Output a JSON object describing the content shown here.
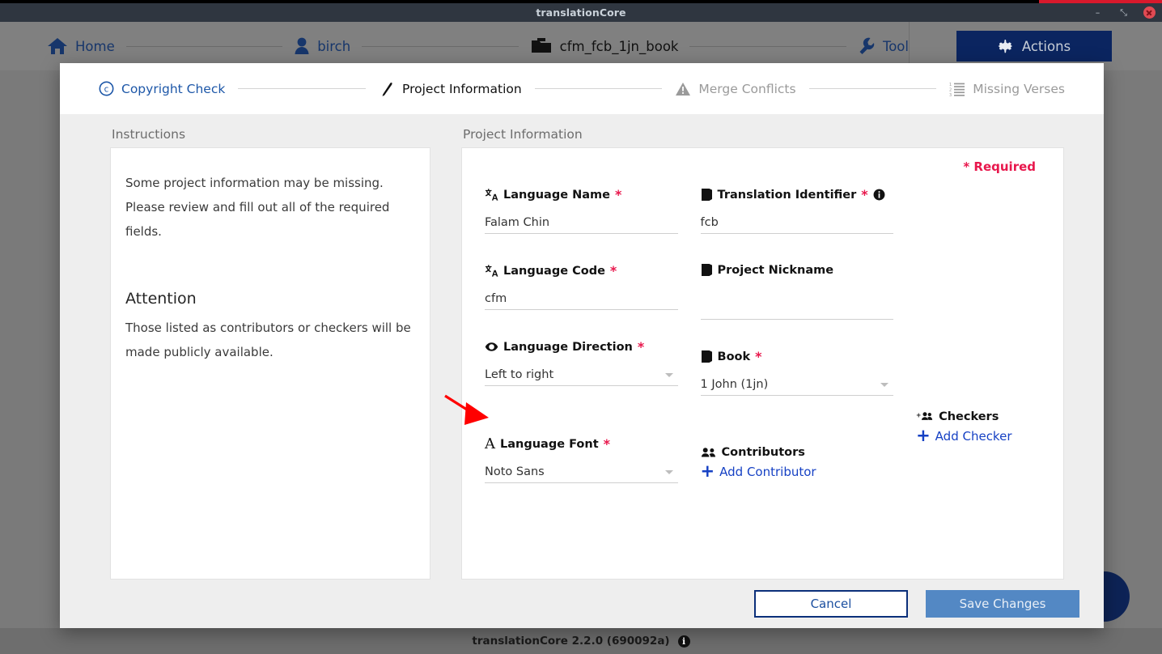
{
  "window": {
    "title": "translationCore",
    "controls": [
      {
        "name": "minimize",
        "glyph": "–"
      },
      {
        "name": "maximize",
        "glyph": "⤡"
      },
      {
        "name": "close",
        "glyph": "×"
      }
    ]
  },
  "topnav": {
    "breadcrumbs": [
      {
        "icon": "home-icon",
        "label": "Home"
      },
      {
        "icon": "user-icon",
        "label": "birch"
      },
      {
        "icon": "folder-icon",
        "label": "cfm_fcb_1jn_book"
      },
      {
        "icon": "wrench-icon",
        "label": "Tool"
      }
    ],
    "actions_label": "Actions",
    "actions_icon": "gear-icon"
  },
  "stepper": {
    "steps": [
      {
        "label": "Copyright Check",
        "icon": "copyright-icon",
        "state": "done"
      },
      {
        "label": "Project Information",
        "icon": "pencil-icon",
        "state": "active"
      },
      {
        "label": "Merge Conflicts",
        "icon": "warning-triangle-icon",
        "state": "todo"
      },
      {
        "label": "Missing Verses",
        "icon": "numbered-list-icon",
        "state": "todo"
      }
    ]
  },
  "instructions": {
    "panel_label": "Instructions",
    "body": "Some project information may be missing. Please review and fill out all of the required fields.",
    "attention_heading": "Attention",
    "attention_body": "Those listed as contributors or checkers will be made publicly available."
  },
  "project_information": {
    "panel_label": "Project Information",
    "required_note": "* Required",
    "fields": {
      "language_name": {
        "label": "Language Name",
        "required": true,
        "icon": "translate-icon",
        "value": "Falam Chin",
        "type": "text"
      },
      "language_code": {
        "label": "Language Code",
        "required": true,
        "icon": "translate-icon",
        "value": "cfm",
        "type": "text"
      },
      "language_direction": {
        "label": "Language Direction",
        "required": true,
        "icon": "eye-icon",
        "value": "Left to right",
        "type": "select"
      },
      "language_font": {
        "label": "Language Font",
        "required": true,
        "icon": "font-a-icon",
        "value": "Noto Sans",
        "type": "select"
      },
      "translation_identifier": {
        "label": "Translation Identifier",
        "required": true,
        "icon": "book-icon",
        "info_icon": "info-icon",
        "value": "fcb",
        "type": "text"
      },
      "project_nickname": {
        "label": "Project Nickname",
        "required": false,
        "icon": "book-icon",
        "value": "",
        "type": "text"
      },
      "book": {
        "label": "Book",
        "required": true,
        "icon": "book-icon",
        "value": "1 John (1jn)",
        "type": "select"
      }
    },
    "contributors": {
      "label": "Contributors",
      "icon": "users-icon",
      "add_label": "Add Contributor"
    },
    "checkers": {
      "label": "Checkers",
      "icon": "add-users-icon",
      "add_label": "Add Checker"
    }
  },
  "modal_footer": {
    "cancel_label": "Cancel",
    "save_label": "Save Changes"
  },
  "app_footer": {
    "version_text": "translationCore 2.2.0 (690092a)",
    "info_icon": "info-icon",
    "info_glyph": "i"
  },
  "annotation": {
    "arrow_color": "#ff0000",
    "points_to": "Language Font"
  },
  "colors": {
    "titlebar": "#2f3640",
    "nav_blue": "#17366b",
    "action_blue": "#0b2560",
    "required_red": "#e8174c",
    "link_blue": "#1641c4",
    "step_done": "#1d57a8",
    "save_blue": "#5388c4",
    "modal_bg": "#eeeeee",
    "desktop": "#7a7a7a"
  }
}
